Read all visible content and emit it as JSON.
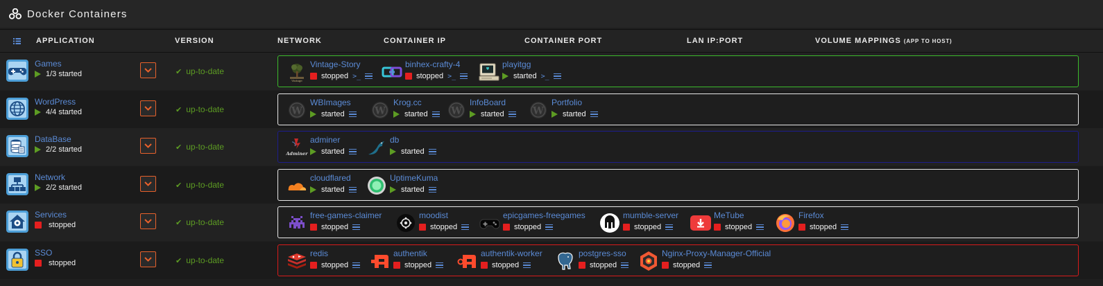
{
  "panel": {
    "title": "Docker Containers",
    "title_icon": "docker-stack-icon"
  },
  "columns": {
    "application": "APPLICATION",
    "version": "VERSION",
    "network": "NETWORK",
    "container_ip": "CONTAINER IP",
    "container_port": "CONTAINER PORT",
    "lan_ip_port": "LAN IP:PORT",
    "volume_mappings": "VOLUME MAPPINGS",
    "volume_mappings_small": "(APP TO HOST)"
  },
  "colors": {
    "link": "#5b8bd6",
    "started": "#5d9c23",
    "stopped": "#e41f1f",
    "dropdown_border": "#e8612b"
  },
  "groups": [
    {
      "name": "Games",
      "state": "started",
      "status": "1/3 started",
      "version": "up-to-date",
      "border_color": "#3cbb2c",
      "icon": "gamepad-icon",
      "containers": [
        {
          "name": "Vintage-Story",
          "state": "stopped",
          "status": "stopped",
          "console": true,
          "icon": "vintage-story-icon"
        },
        {
          "name": "binhex-crafty-4",
          "state": "stopped",
          "status": "stopped",
          "console": true,
          "icon": "crafty-link-icon"
        },
        {
          "name": "playitgg",
          "state": "started",
          "status": "started",
          "console": true,
          "icon": "retro-computer-icon"
        }
      ]
    },
    {
      "name": "WordPress",
      "state": "started",
      "status": "4/4 started",
      "version": "up-to-date",
      "border_color": "#e8e8e8",
      "icon": "globe-icon",
      "containers": [
        {
          "name": "WBImages",
          "state": "started",
          "status": "started",
          "console": false,
          "icon": "wordpress-icon"
        },
        {
          "name": "Krog.cc",
          "state": "started",
          "status": "started",
          "console": false,
          "icon": "wordpress-icon"
        },
        {
          "name": "InfoBoard",
          "state": "started",
          "status": "started",
          "console": false,
          "icon": "wordpress-icon"
        },
        {
          "name": "Portfolio",
          "state": "started",
          "status": "started",
          "console": false,
          "icon": "wordpress-icon"
        }
      ]
    },
    {
      "name": "DataBase",
      "state": "started",
      "status": "2/2 started",
      "version": "up-to-date",
      "border_color": "#1d1d8c",
      "icon": "database-icon",
      "containers": [
        {
          "name": "adminer",
          "state": "started",
          "status": "started",
          "console": false,
          "icon": "adminer-icon",
          "icon_label": "Adminer"
        },
        {
          "name": "db",
          "state": "started",
          "status": "started",
          "console": false,
          "icon": "mariadb-seal-icon"
        }
      ]
    },
    {
      "name": "Network",
      "state": "started",
      "status": "2/2 started",
      "version": "up-to-date",
      "border_color": "#e8e8e8",
      "icon": "network-diagram-icon",
      "containers": [
        {
          "name": "cloudflared",
          "state": "started",
          "status": "started",
          "console": false,
          "icon": "cloudflare-icon"
        },
        {
          "name": "UptimeKuma",
          "state": "started",
          "status": "started",
          "console": false,
          "icon": "uptime-kuma-icon"
        }
      ]
    },
    {
      "name": "Services",
      "state": "stopped",
      "status": "stopped",
      "version": "up-to-date",
      "border_color": "#e8e8e8",
      "icon": "gear-house-icon",
      "containers": [
        {
          "name": "free-games-claimer",
          "state": "stopped",
          "status": "stopped",
          "console": false,
          "icon": "space-invader-icon"
        },
        {
          "name": "moodist",
          "state": "stopped",
          "status": "stopped",
          "console": false,
          "icon": "moodist-icon"
        },
        {
          "name": "epicgames-freegames",
          "state": "stopped",
          "status": "stopped",
          "console": false,
          "icon": "gamepad-black-icon"
        },
        {
          "name": "mumble-server",
          "state": "stopped",
          "status": "stopped",
          "console": false,
          "icon": "mumble-icon"
        },
        {
          "name": "MeTube",
          "state": "stopped",
          "status": "stopped",
          "console": false,
          "icon": "metube-download-icon"
        },
        {
          "name": "Firefox",
          "state": "stopped",
          "status": "stopped",
          "console": false,
          "icon": "firefox-icon"
        }
      ]
    },
    {
      "name": "SSO",
      "state": "stopped",
      "status": "stopped",
      "version": "up-to-date",
      "border_color": "#d91b1b",
      "icon": "padlock-icon",
      "containers": [
        {
          "name": "redis",
          "state": "stopped",
          "status": "stopped",
          "console": false,
          "icon": "redis-icon"
        },
        {
          "name": "authentik",
          "state": "stopped",
          "status": "stopped",
          "console": false,
          "icon": "authentik-icon"
        },
        {
          "name": "authentik-worker",
          "state": "stopped",
          "status": "stopped",
          "console": false,
          "icon": "authentik-worker-icon"
        },
        {
          "name": "postgres-sso",
          "state": "stopped",
          "status": "stopped",
          "console": false,
          "icon": "postgresql-elephant-icon"
        },
        {
          "name": "Nginx-Proxy-Manager-Official",
          "state": "stopped",
          "status": "stopped",
          "console": false,
          "icon": "nginx-proxy-manager-icon"
        }
      ]
    }
  ]
}
